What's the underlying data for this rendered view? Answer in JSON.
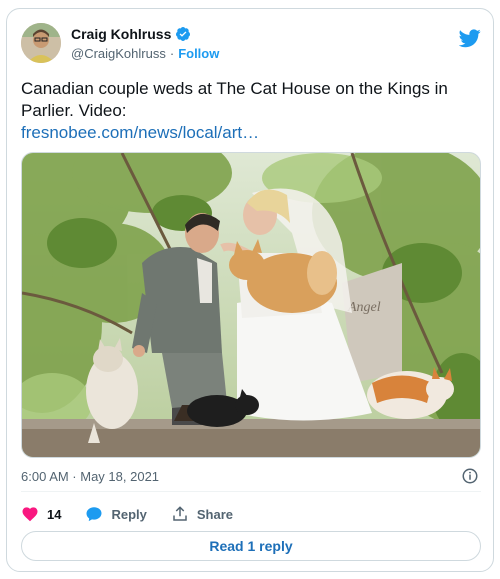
{
  "author": {
    "name": "Craig Kohlruss",
    "handle": "@CraigKohlruss",
    "separator": "·",
    "follow_label": "Follow",
    "avatar_icon": "avatar-photo",
    "verified_icon": "verified-badge-icon"
  },
  "tweet": {
    "text": "Canadian couple weds at The Cat House on the Kings in Parlier. Video:",
    "link": "fresnobee.com/news/local/art…",
    "media_sign": "Angel"
  },
  "meta": {
    "timestamp": "6:00 AM · May 18, 2021"
  },
  "actions": {
    "like_count": "14",
    "reply_label": "Reply",
    "share_label": "Share"
  },
  "footer": {
    "read_reply_label": "Read 1 reply"
  },
  "colors": {
    "accent": "#1d9bf0",
    "link": "#1d6fb8",
    "like": "#f91880",
    "text": "#0f1419",
    "muted": "#536471"
  }
}
